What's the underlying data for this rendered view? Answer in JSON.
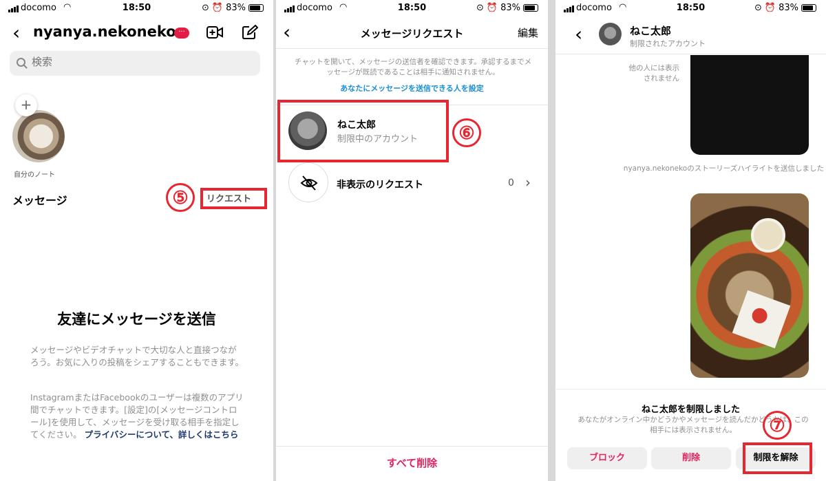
{
  "status": {
    "carrier": "docomo",
    "time": "18:50",
    "battery": "83%"
  },
  "panel1": {
    "username": "nyanya.nekoneko",
    "badge": "···",
    "search_placeholder": "検索",
    "note_label": "自分のノート",
    "messages_title": "メッセージ",
    "requests_link": "リクエスト",
    "step": "⑤",
    "empty_title": "友達にメッセージを送信",
    "empty_body": "メッセージやビデオチャットで大切な人と直接つながろう。お気に入りの投稿をシェアすることもできます。",
    "info_body": "InstagramまたはFacebookのユーザーは複数のアプリ間でチャットできます。[設定]の[メッセージコントロール]を使用して、メッセージを受け取る相手を指定してください。",
    "info_link": "プライバシーについて、詳しくはこちら"
  },
  "panel2": {
    "title": "メッセージリクエスト",
    "edit": "編集",
    "info_text": "チャットを開いて、メッセージの送信者を確認できます。承認するまでメッセージが既読であることは相手に通知されません。",
    "info_link": "あなたにメッセージを送信できる人を設定",
    "request_name": "ねこ太郎",
    "request_sub": "制限中のアカウント",
    "step": "⑥",
    "hidden_label": "非表示のリクエスト",
    "hidden_count": "0",
    "delete_all": "すべて削除"
  },
  "panel3": {
    "name": "ねこ太郎",
    "sub": "制限されたアカウント",
    "hidden_note": "他の人には表示されません",
    "highlight_note": "nyanya.nekonekoのストーリーズハイライトを送信しました",
    "restricted_title": "ねこ太郎を制限しました",
    "restricted_body": "あなたがオンライン中かどうかやメッセージを読んだかどうかは、この相手には表示されません。",
    "btn_block": "ブロック",
    "btn_delete": "削除",
    "btn_unrestrict": "制限を解除",
    "step": "⑦"
  },
  "colors": {
    "accent_red": "#e8262f",
    "link_blue": "#1a8fd6",
    "danger": "#e0245e"
  }
}
